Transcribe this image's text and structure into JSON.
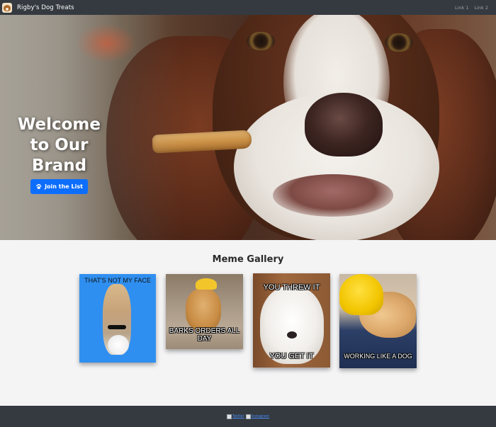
{
  "navbar": {
    "brand_name": "Rigby's Dog Treats",
    "links": [
      "Link 1",
      "Link 2"
    ],
    "background": "#343a40"
  },
  "hero": {
    "title": "Welcome to Our Brand",
    "button_label": "Join the List",
    "button_icon": "paw-icon",
    "button_color": "#0d6efd"
  },
  "gallery": {
    "title": "Meme Gallery",
    "memes": [
      {
        "caption_top": "THAT'S NOT MY FACE",
        "caption_bottom": ""
      },
      {
        "caption_top": "",
        "caption_bottom": "BARKS ORDERS ALL DAY"
      },
      {
        "caption_top": "YOU THREW IT",
        "caption_bottom": "YOU GET IT"
      },
      {
        "caption_top": "",
        "caption_bottom": "WORKING LIKE A DOG"
      }
    ]
  },
  "footer": {
    "links": [
      "Twitter",
      "Instagram"
    ],
    "background": "#343a40"
  }
}
